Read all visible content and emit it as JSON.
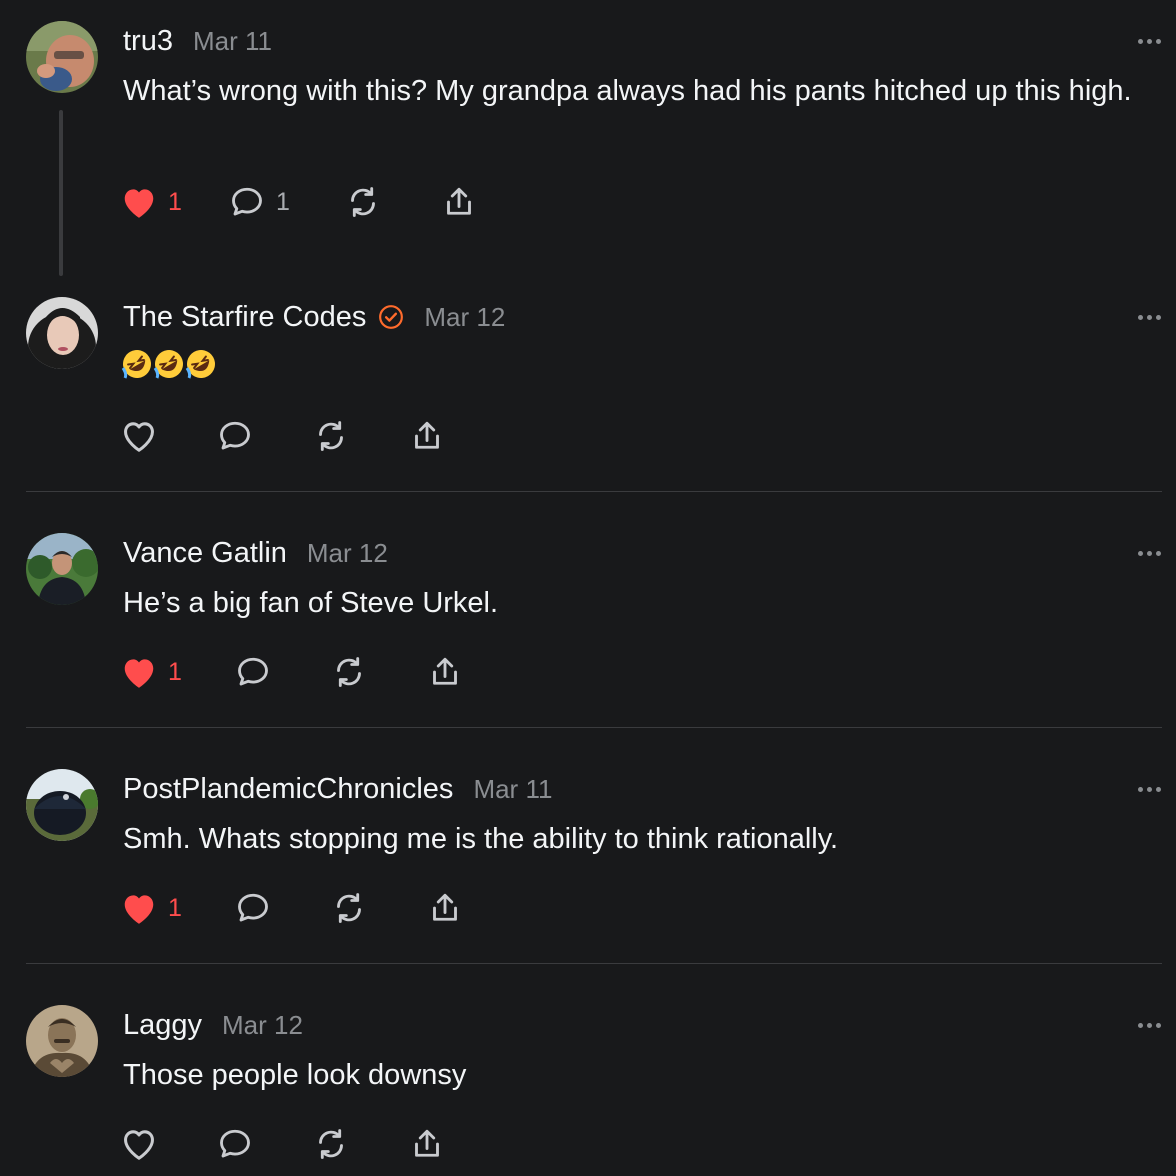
{
  "posts": [
    {
      "username": "tru3",
      "date": "Mar 11",
      "text": "What’s wrong with this? My grandpa always had his pants hitched up this high.",
      "likes": "1",
      "comments": "1",
      "liked": true,
      "verified": false
    },
    {
      "username": "The Starfire Codes",
      "date": "Mar 12",
      "text": "🤣🤣🤣",
      "likes": "",
      "comments": "",
      "liked": false,
      "verified": true
    },
    {
      "username": "Vance Gatlin",
      "date": "Mar 12",
      "text": "He’s a big fan of Steve Urkel.",
      "likes": "1",
      "comments": "",
      "liked": true,
      "verified": false
    },
    {
      "username": "PostPlandemicChronicles",
      "date": "Mar 11",
      "text": "Smh. Whats stopping me is the ability to think rationally.",
      "likes": "1",
      "comments": "",
      "liked": true,
      "verified": false
    },
    {
      "username": "Laggy",
      "date": "Mar 12",
      "text": "Those people look downsy",
      "likes": "",
      "comments": "",
      "liked": false,
      "verified": false
    }
  ],
  "icons": {
    "like": "heart-icon",
    "comment": "comment-bubble-icon",
    "repost": "repost-icon",
    "share": "share-icon",
    "more": "more-options-icon",
    "verified": "verified-badge-icon"
  },
  "colors": {
    "background": "#18191b",
    "liked": "#ff4d4d",
    "verified": "#ff6b2c",
    "muted": "#8a8d91"
  }
}
